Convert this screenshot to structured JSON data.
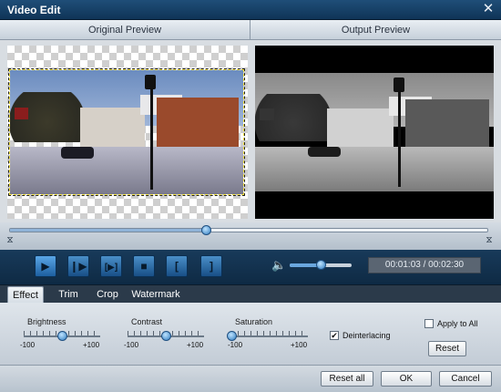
{
  "window": {
    "title": "Video Edit",
    "close_icon": "close-icon"
  },
  "preview": {
    "original_label": "Original Preview",
    "output_label": "Output Preview"
  },
  "timeline": {
    "progress": 0.41
  },
  "player": {
    "buttons": [
      {
        "name": "play-icon",
        "glyph": "▶"
      },
      {
        "name": "step-forward-icon",
        "glyph": "❙▶"
      },
      {
        "name": "fit-frame-icon",
        "glyph": "[▶]"
      },
      {
        "name": "stop-icon",
        "glyph": "■"
      },
      {
        "name": "mark-in-icon",
        "glyph": "["
      },
      {
        "name": "mark-out-icon",
        "glyph": "]"
      }
    ],
    "volume_icon": "speaker-icon",
    "volume": 0.5,
    "time": "00:01:03 / 00:02:30"
  },
  "tabs": [
    {
      "label": "Effect",
      "active": true
    },
    {
      "label": "Trim",
      "active": false
    },
    {
      "label": "Crop",
      "active": false
    },
    {
      "label": "Watermark",
      "active": false
    }
  ],
  "effect": {
    "brightness": {
      "label": "Brightness",
      "min": "-100",
      "max": "+100",
      "value": 0
    },
    "contrast": {
      "label": "Contrast",
      "min": "-100",
      "max": "+100",
      "value": 0
    },
    "saturation": {
      "label": "Saturation",
      "min": "-100",
      "max": "+100",
      "value": -100
    },
    "deinterlacing": {
      "label": "Deinterlacing",
      "checked": true
    },
    "apply_to_all": {
      "label": "Apply to All",
      "checked": false
    },
    "reset_label": "Reset"
  },
  "footer": {
    "reset_all": "Reset all",
    "ok": "OK",
    "cancel": "Cancel"
  }
}
